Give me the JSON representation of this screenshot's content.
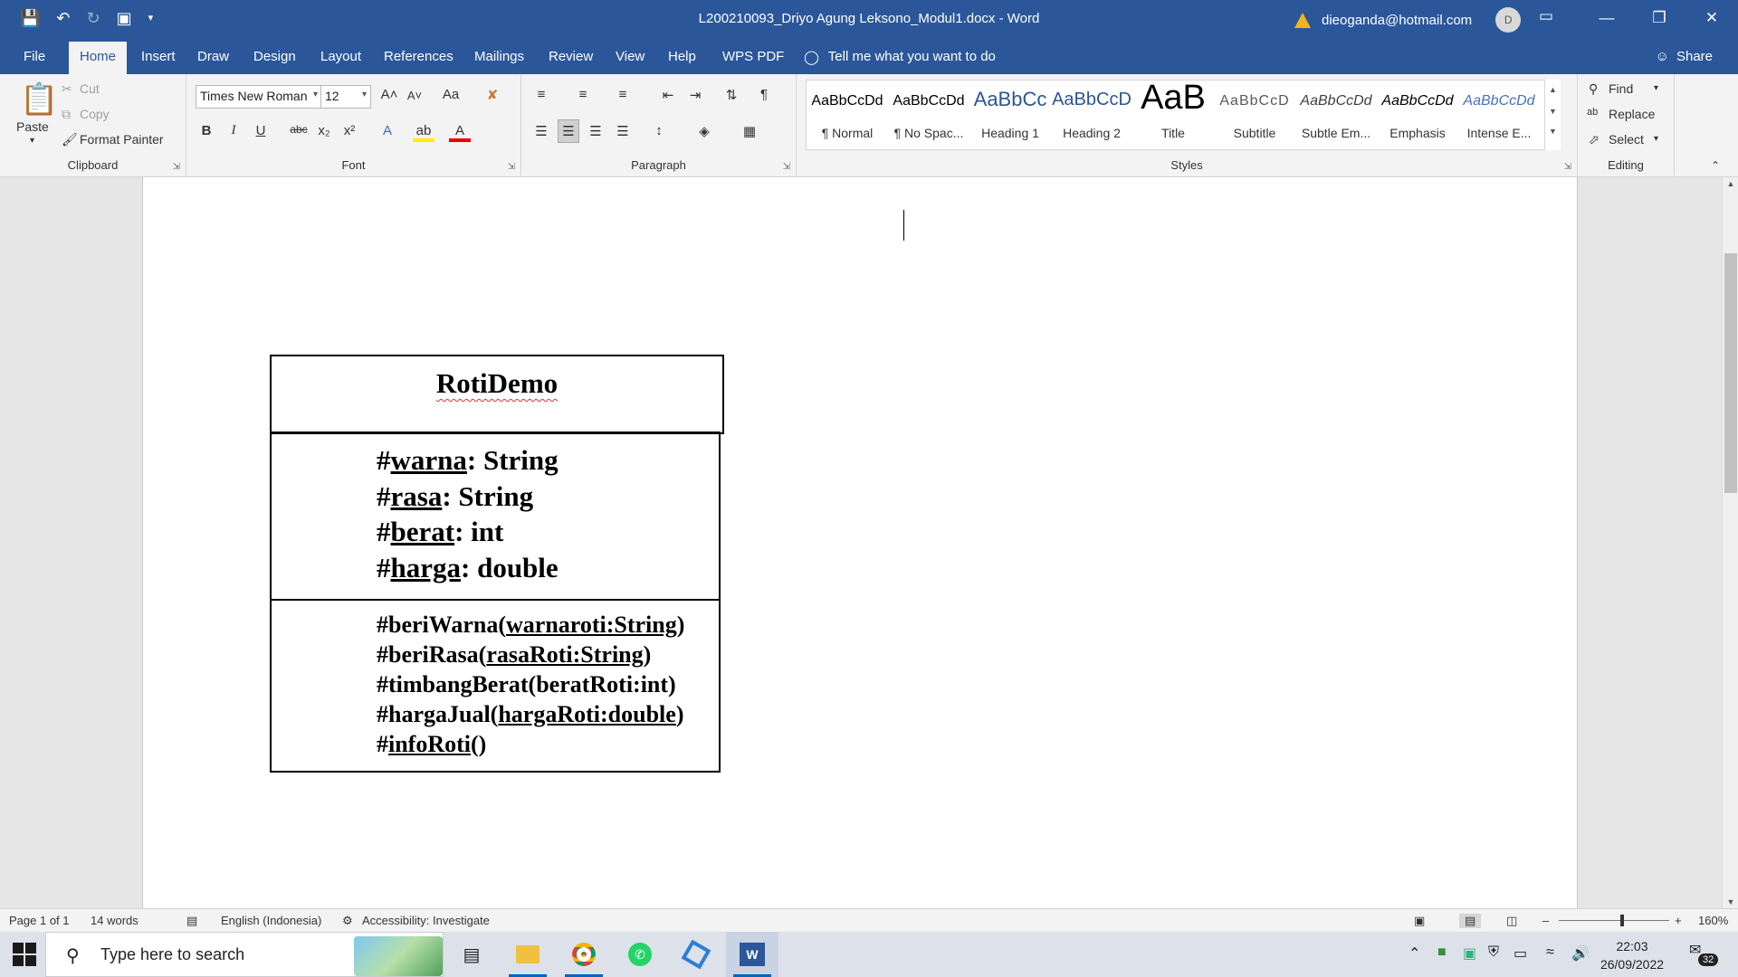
{
  "window": {
    "title": "L200210093_Driyo Agung Leksono_Modul1.docx  -  Word",
    "account_email": "dieoganda@hotmail.com",
    "avatar_initial": "D"
  },
  "menu_tabs": [
    "File",
    "Home",
    "Insert",
    "Draw",
    "Design",
    "Layout",
    "References",
    "Mailings",
    "Review",
    "View",
    "Help",
    "WPS PDF"
  ],
  "active_tab": "Home",
  "tell_me": "Tell me what you want to do",
  "share_label": "Share",
  "clipboard": {
    "paste": "Paste",
    "cut": "Cut",
    "copy": "Copy",
    "format_painter": "Format Painter",
    "label": "Clipboard"
  },
  "font": {
    "family": "Times New Roman",
    "size": "12",
    "label": "Font"
  },
  "paragraph": {
    "label": "Paragraph"
  },
  "styles": {
    "label": "Styles",
    "items": [
      {
        "sample": "AaBbCcDd",
        "name": "¶ Normal"
      },
      {
        "sample": "AaBbCcDd",
        "name": "¶ No Spac..."
      },
      {
        "sample": "AaBbCc",
        "name": "Heading 1"
      },
      {
        "sample": "AaBbCcD",
        "name": "Heading 2"
      },
      {
        "sample": "AaB",
        "name": "Title"
      },
      {
        "sample": "AaBbCcD",
        "name": "Subtitle"
      },
      {
        "sample": "AaBbCcDd",
        "name": "Subtle Em..."
      },
      {
        "sample": "AaBbCcDd",
        "name": "Emphasis"
      },
      {
        "sample": "AaBbCcDd",
        "name": "Intense E..."
      }
    ]
  },
  "editing": {
    "find": "Find",
    "replace": "Replace",
    "select": "Select",
    "label": "Editing"
  },
  "uml": {
    "class_name": "RotiDemo",
    "attributes": [
      {
        "prefix": "#",
        "name": "warna",
        "type": ": String"
      },
      {
        "prefix": "#",
        "name": "rasa",
        "type": ": String"
      },
      {
        "prefix": "#",
        "name": "berat",
        "type": ": int"
      },
      {
        "prefix": "#",
        "name": "harga",
        "type": ": double"
      }
    ],
    "methods": [
      {
        "head": "#beriWarna(",
        "param": "warnaroti:String",
        "tail": ")"
      },
      {
        "head": "#beriRasa(",
        "param": "rasaRoti:String",
        "tail": ")"
      },
      {
        "head": "#timbangBerat(beratRoti:int)",
        "param": "",
        "tail": ""
      },
      {
        "head": "#hargaJual(",
        "param": "hargaRoti:double",
        "tail": ")"
      },
      {
        "head": "#",
        "param": "infoRoti",
        "tail": "()"
      }
    ]
  },
  "status": {
    "page": "Page 1 of 1",
    "words": "14 words",
    "language": "English (Indonesia)",
    "accessibility": "Accessibility: Investigate",
    "zoom": "160%"
  },
  "taskbar": {
    "search_placeholder": "Type here to search",
    "time": "22:03",
    "date": "26/09/2022",
    "notifications": "32"
  }
}
